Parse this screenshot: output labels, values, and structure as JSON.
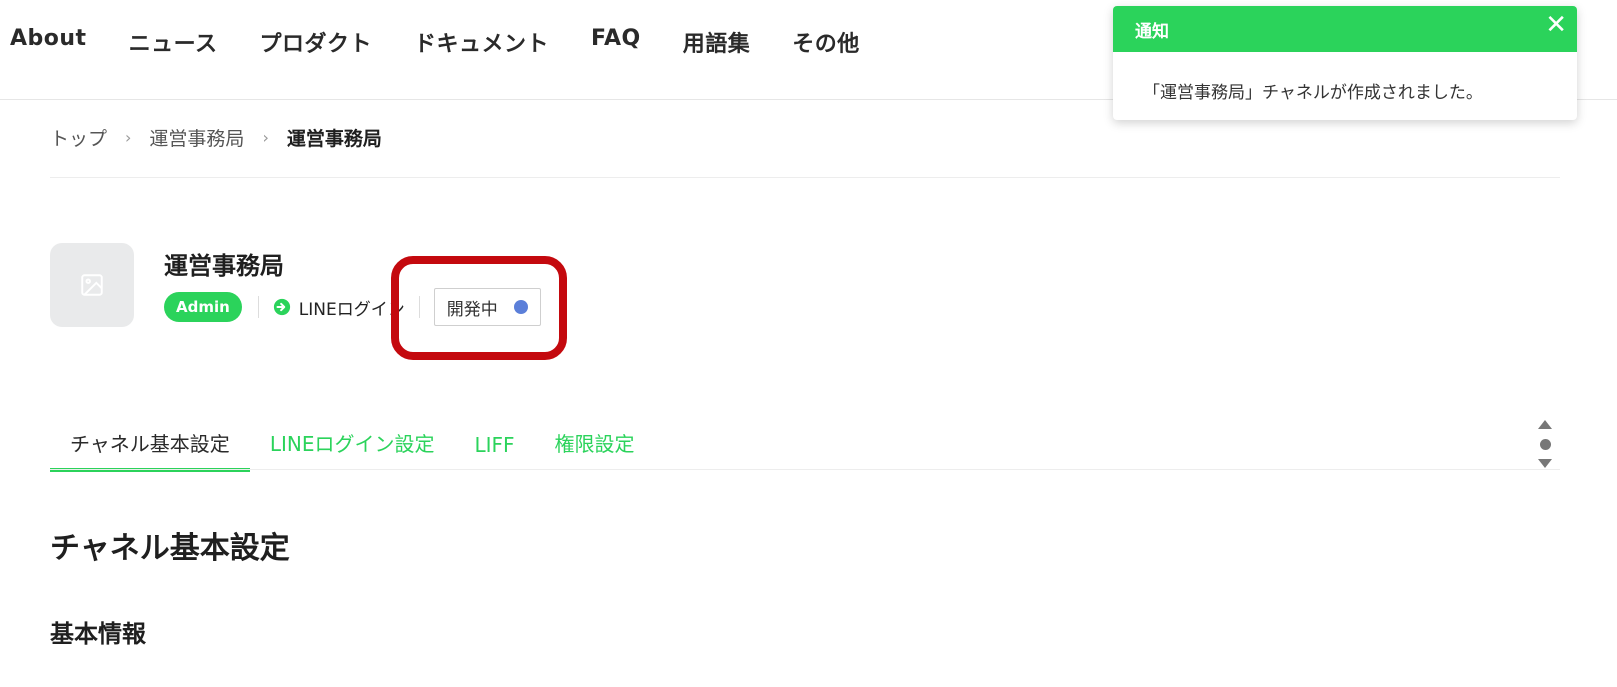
{
  "nav": {
    "items": [
      "About",
      "ニュース",
      "プロダクト",
      "ドキュメント",
      "FAQ",
      "用語集",
      "その他"
    ]
  },
  "breadcrumb": {
    "items": [
      "トップ",
      "運営事務局",
      "運営事務局"
    ]
  },
  "channel": {
    "name": "運営事務局",
    "role_badge": "Admin",
    "type_label": "LINEログイン",
    "status_label": "開発中",
    "status_color": "#5b7fd9"
  },
  "tabs": [
    {
      "label": "チャネル基本設定",
      "active": true
    },
    {
      "label": "LINEログイン設定",
      "active": false
    },
    {
      "label": "LIFF",
      "active": false
    },
    {
      "label": "権限設定",
      "active": false
    }
  ],
  "content": {
    "section_title": "チャネル基本設定",
    "subsection_title": "基本情報"
  },
  "toast": {
    "title": "通知",
    "message": "「運営事務局」チャネルが作成されました。",
    "close_symbol": "✕"
  },
  "colors": {
    "accent": "#2bd35b",
    "highlight": "#c4090e"
  }
}
